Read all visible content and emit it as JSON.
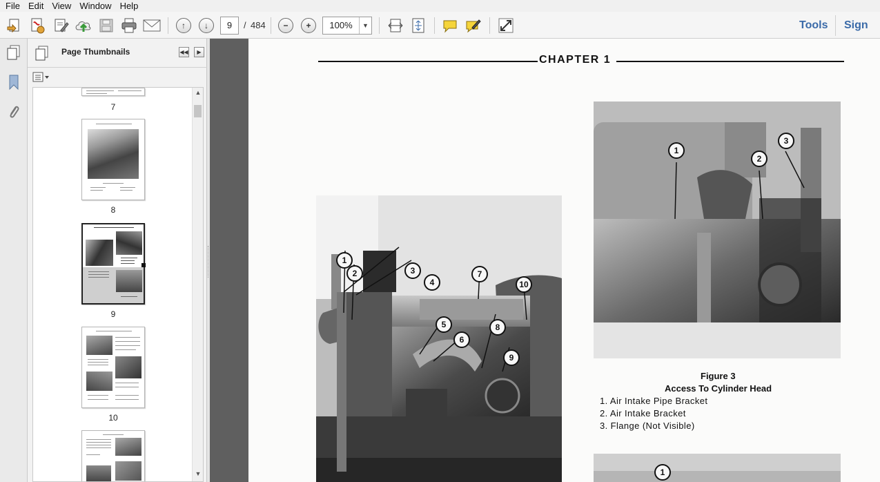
{
  "menu": [
    "File",
    "Edit",
    "View",
    "Window",
    "Help"
  ],
  "toolbar": {
    "current_page": "9",
    "page_separator": "/",
    "total_pages": "484",
    "zoom": "100%",
    "tools_label": "Tools",
    "sign_label": "Sign"
  },
  "thumbnails_panel": {
    "title": "Page Thumbnails",
    "pages": [
      {
        "label": "7"
      },
      {
        "label": "8"
      },
      {
        "label": "9",
        "selected": true
      },
      {
        "label": "10"
      }
    ]
  },
  "document": {
    "chapter_heading": "CHAPTER 1",
    "left_figure_callouts": [
      "1",
      "2",
      "3",
      "4",
      "5",
      "6",
      "7",
      "8",
      "9",
      "10"
    ],
    "right_figure_callouts": [
      "1",
      "2",
      "3"
    ],
    "bottom_figure_callouts": [
      "1"
    ],
    "caption": {
      "figure": "Figure 3",
      "title": "Access To Cylinder Head",
      "items": [
        "1.  Air Intake Pipe Bracket",
        "2.  Air Intake Bracket",
        "3.  Flange (Not Visible)"
      ]
    }
  }
}
